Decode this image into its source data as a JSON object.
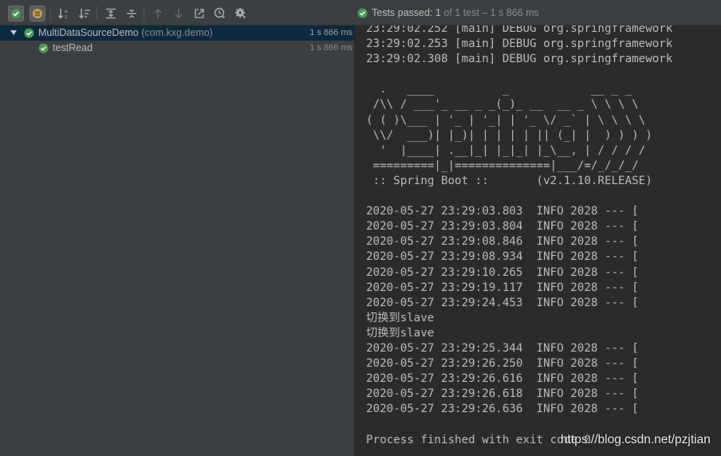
{
  "toolbar": {
    "buttons": [
      {
        "icon": "show-passed-icon",
        "toggled": true
      },
      {
        "icon": "show-ignored-icon",
        "toggled": true
      },
      {
        "icon": "sort-alphabetically-icon"
      },
      {
        "icon": "sort-by-duration-icon"
      },
      {
        "icon": "expand-all-icon"
      },
      {
        "icon": "collapse-all-icon"
      },
      {
        "icon": "previous-failed-test-icon"
      },
      {
        "icon": "next-failed-test-icon"
      },
      {
        "icon": "import-tests-icon"
      },
      {
        "icon": "test-history-icon"
      },
      {
        "icon": "settings-gear-icon"
      }
    ]
  },
  "status": {
    "prefix": "Tests passed:",
    "count": "1",
    "suffix": "of 1 test – 1 s 866 ms"
  },
  "tree": {
    "root": {
      "name": "MultiDataSourceDemo",
      "package": "(com.kxg.demo)",
      "time": "1 s 866 ms"
    },
    "child": {
      "name": "testRead",
      "time": "1 s 866 ms"
    }
  },
  "console": {
    "lines": [
      "23:29:02.252 [main] DEBUG org.springframework",
      "23:29:02.253 [main] DEBUG org.springframework",
      "23:29:02.308 [main] DEBUG org.springframework",
      "",
      "  .   ____          _            __ _ _",
      " /\\\\ / ___'_ __ _ _(_)_ __  __ _ \\ \\ \\ \\",
      "( ( )\\___ | '_ | '_| | '_ \\/ _` | \\ \\ \\ \\",
      " \\\\/  ___)| |_)| | | | | || (_| |  ) ) ) )",
      "  '  |____| .__|_| |_|_| |_\\__, | / / / /",
      " =========|_|==============|___/=/_/_/_/",
      " :: Spring Boot ::       (v2.1.10.RELEASE)",
      "",
      "2020-05-27 23:29:03.803  INFO 2028 --- [",
      "2020-05-27 23:29:03.804  INFO 2028 --- [",
      "2020-05-27 23:29:08.846  INFO 2028 --- [",
      "2020-05-27 23:29:08.934  INFO 2028 --- [",
      "2020-05-27 23:29:10.265  INFO 2028 --- [",
      "2020-05-27 23:29:19.117  INFO 2028 --- [",
      "2020-05-27 23:29:24.453  INFO 2028 --- [",
      "切换到slave",
      "切换到slave",
      "2020-05-27 23:29:25.344  INFO 2028 --- [",
      "2020-05-27 23:29:26.250  INFO 2028 --- [",
      "2020-05-27 23:29:26.616  INFO 2028 --- [",
      "2020-05-27 23:29:26.618  INFO 2028 --- [",
      "2020-05-27 23:29:26.636  INFO 2028 --- [",
      "",
      "Process finished with exit code 0"
    ]
  },
  "watermark": "https://blog.csdn.net/pzjtian",
  "colors": {
    "pass_green": "#499c54",
    "panel_bg": "#3c3f41",
    "console_bg": "#2b2b2b",
    "selection_bg": "#0d293e",
    "text": "#bbbbbb"
  }
}
